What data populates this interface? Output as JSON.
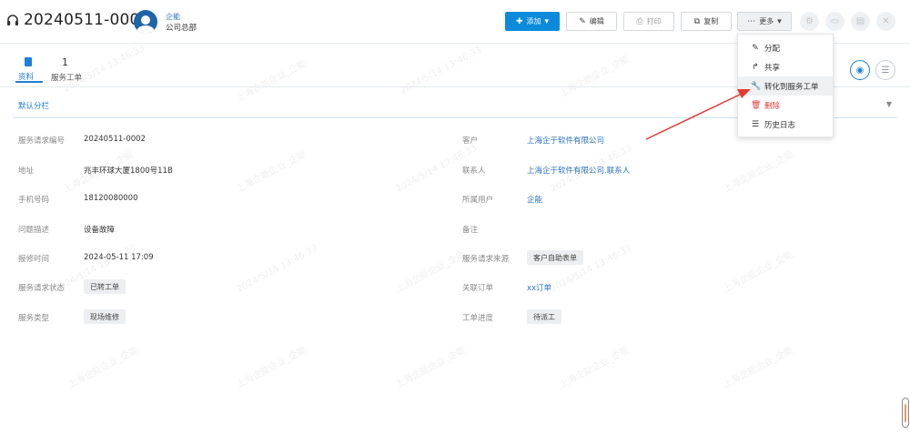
{
  "header": {
    "title": "20240511-0002",
    "owner_name": "企能",
    "owner_org": "公司总部",
    "buttons": {
      "add": "添加",
      "edit": "编辑",
      "print": "打印",
      "copy": "复制",
      "more": "更多"
    }
  },
  "tabs": {
    "doc_label": "资料",
    "service_count": "1",
    "service_label": "服务工单"
  },
  "group": {
    "title": "默认分栏"
  },
  "fields_left": [
    {
      "label": "服务请求编号",
      "value": "20240511-0002"
    },
    {
      "label": "地址",
      "value": "兆丰环球大厦1800号11B"
    },
    {
      "label": "手机号码",
      "value": "18120080000"
    },
    {
      "label": "问题描述",
      "value": "设备故障"
    },
    {
      "label": "报修时间",
      "value": "2024-05-11 17:09"
    },
    {
      "label": "服务请求状态",
      "value": "已转工单"
    },
    {
      "label": "服务类型",
      "value": "现场维修"
    }
  ],
  "fields_right": [
    {
      "label": "客户",
      "value": "上海企于软件有限公司"
    },
    {
      "label": "联系人",
      "value": "上海企于软件有限公司.联系人"
    },
    {
      "label": "所属用户",
      "value": "企能"
    },
    {
      "label": "备注",
      "value": ""
    },
    {
      "label": "服务请求来源",
      "value": "客户自助表单"
    },
    {
      "label": "关联订单",
      "value": "xx订单"
    },
    {
      "label": "工单进度",
      "value": "待派工"
    }
  ],
  "more_menu": [
    {
      "label": "分配",
      "icon": "edit-icon"
    },
    {
      "label": "共享",
      "icon": "share-icon"
    },
    {
      "label": "转化到服务工单",
      "icon": "wrench-icon"
    },
    {
      "label": "删除",
      "icon": "trash-icon"
    },
    {
      "label": "历史日志",
      "icon": "list-icon"
    }
  ],
  "watermark": {
    "text_date": "2024/5/14 13:46:33",
    "text_company": "上海企能企业_企能"
  },
  "colors": {
    "primary": "#0c8bdb",
    "link": "#2a73c4",
    "danger": "#e23b3b",
    "arrow": "#e53935"
  }
}
